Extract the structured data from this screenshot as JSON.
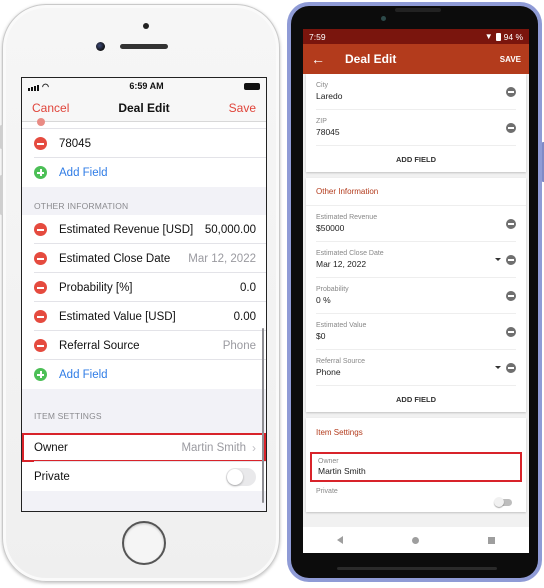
{
  "ios": {
    "status": {
      "time": "6:59 AM"
    },
    "nav": {
      "cancel_label": "Cancel",
      "title": "Deal Edit",
      "save_label": "Save"
    },
    "address_rows": [
      {
        "value": "78045"
      }
    ],
    "add_field_label": "Add Field",
    "other_information": {
      "header": "OTHER INFORMATION",
      "rows": [
        {
          "label": "Estimated Revenue [USD]",
          "value": "50,000.00"
        },
        {
          "label": "Estimated Close Date",
          "value": "Mar 12, 2022"
        },
        {
          "label": "Probability [%]",
          "value": "0.0"
        },
        {
          "label": "Estimated Value [USD]",
          "value": "0.00"
        },
        {
          "label": "Referral Source",
          "value": "Phone"
        }
      ],
      "add_field_label": "Add Field"
    },
    "item_settings": {
      "header": "ITEM SETTINGS",
      "owner_label": "Owner",
      "owner_value": "Martin Smith",
      "private_label": "Private",
      "private_on": false
    }
  },
  "android": {
    "status": {
      "time": "7:59",
      "battery": "94 %"
    },
    "toolbar": {
      "title": "Deal Edit",
      "save_label": "SAVE"
    },
    "address_fields": [
      {
        "label": "City",
        "value": "Laredo"
      },
      {
        "label": "ZIP",
        "value": "78045"
      }
    ],
    "add_field_label": "ADD FIELD",
    "other_information": {
      "title": "Other Information",
      "fields": [
        {
          "label": "Estimated Revenue",
          "value": "$50000",
          "dropdown": false
        },
        {
          "label": "Estimated Close Date",
          "value": "Mar 12, 2022",
          "dropdown": true
        },
        {
          "label": "Probability",
          "value": "0 %",
          "dropdown": false
        },
        {
          "label": "Estimated Value",
          "value": "$0",
          "dropdown": false
        },
        {
          "label": "Referral Source",
          "value": "Phone",
          "dropdown": true
        }
      ],
      "add_field_label": "ADD FIELD"
    },
    "item_settings": {
      "title": "Item Settings",
      "owner_label": "Owner",
      "owner_value": "Martin Smith",
      "private_label": "Private",
      "private_on": false
    }
  },
  "colors": {
    "ios_destructive": "#e54b3f",
    "ios_add": "#4cbf56",
    "ios_link": "#2f7ce6",
    "android_primary": "#b33b1c",
    "android_status": "#7a150d",
    "highlight": "#d8232a"
  }
}
